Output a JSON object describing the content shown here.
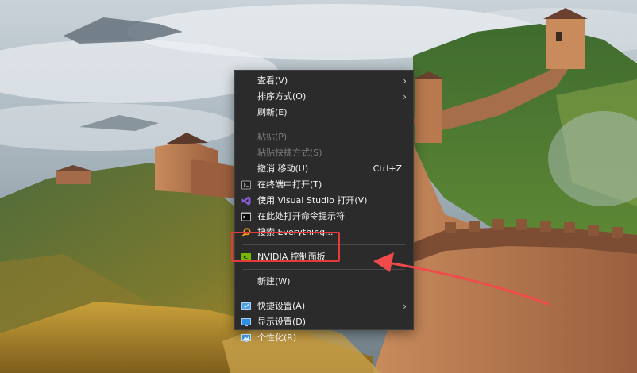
{
  "context_menu": {
    "items": [
      {
        "label": "查看(V)",
        "submenu": "›"
      },
      {
        "label": "排序方式(O)",
        "submenu": "›"
      },
      {
        "label": "刷新(E)"
      },
      {
        "label": "粘贴(P)"
      },
      {
        "label": "粘贴快捷方式(S)"
      },
      {
        "label": "撤消 移动(U)",
        "shortcut": "Ctrl+Z"
      },
      {
        "label": "在终端中打开(T)",
        "icon": "terminal-icon"
      },
      {
        "label": "使用 Visual Studio 打开(V)",
        "icon": "visual-studio-icon"
      },
      {
        "label": "在此处打开命令提示符",
        "icon": "command-prompt-icon"
      },
      {
        "label": "搜索 Everything...",
        "icon": "everything-search-icon"
      },
      {
        "label": "NVIDIA 控制面板",
        "icon": "nvidia-icon"
      },
      {
        "label": "新建(W)"
      },
      {
        "label": "快捷设置(A)",
        "icon": "quick-settings-icon",
        "submenu": "›"
      },
      {
        "label": "显示设置(D)",
        "icon": "display-settings-icon"
      },
      {
        "label": "个性化(R)",
        "icon": "personalize-icon"
      }
    ]
  },
  "colors": {
    "menu_bg": "#2b2b2b",
    "menu_text": "#f2f2f2",
    "disabled_text": "#7d7d7d",
    "highlight": "#e53a3a"
  }
}
